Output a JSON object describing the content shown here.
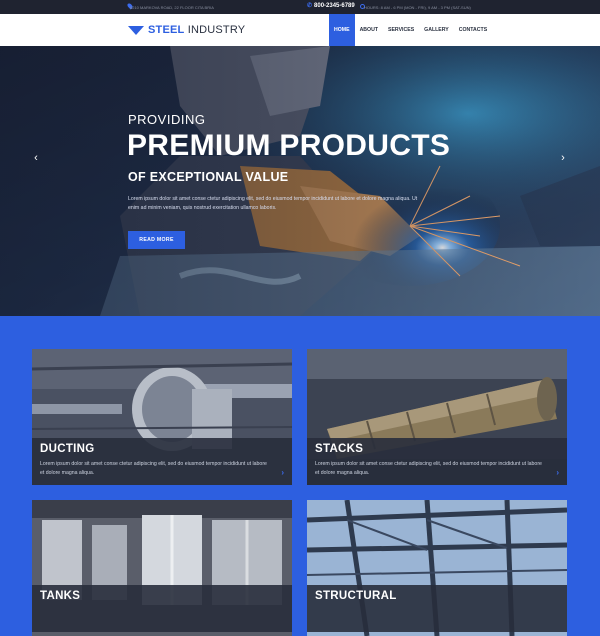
{
  "topbar": {
    "address": "8210 MARKOVA ROAD, 22 FLOOR CITA BRIA",
    "phone": "800-2345-6789",
    "hours": "HOURS: 8 AM - 6 PM (MON - FRI), 9 AM - 3 PM (SAT-SUN)"
  },
  "brand": {
    "name_bold": "STEEL",
    "name_rest": " INDUSTRY"
  },
  "nav": {
    "items": [
      "HOME",
      "ABOUT",
      "SERVICES",
      "GALLERY",
      "CONTACTS"
    ],
    "active": "HOME"
  },
  "hero": {
    "pre": "PROVIDING",
    "title": "PREMIUM PRODUCTS",
    "subtitle": "OF EXCEPTIONAL VALUE",
    "text": "Lorem ipsum dolor sit amet conse ctetur adipiscing elit, sed do eiusmod tempor incididunt ut labore et dolore magna aliqua. Ut enim ad minim veniam, quis nostrud exercitation ullamco laboris.",
    "button": "READ MORE",
    "prev_icon": "‹",
    "next_icon": "›"
  },
  "cards": [
    {
      "title": "DUCTING",
      "desc": "Lorem ipsum dolor sit amet conse ctetur adipiscing elit, sed do eiusmod tempor incididunt ut labore et dolore magna aliqua.",
      "more_icon": "›"
    },
    {
      "title": "STACKS",
      "desc": "Lorem ipsum dolor sit amet conse ctetur adipiscing elit, sed do eiusmod tempor incididunt ut labore et dolore magna aliqua.",
      "more_icon": "›"
    },
    {
      "title": "TANKS"
    },
    {
      "title": "STRUCTURAL"
    }
  ],
  "colors": {
    "accent": "#2d5fe0",
    "dark": "#1f2330",
    "background": "#2d5fe0"
  }
}
